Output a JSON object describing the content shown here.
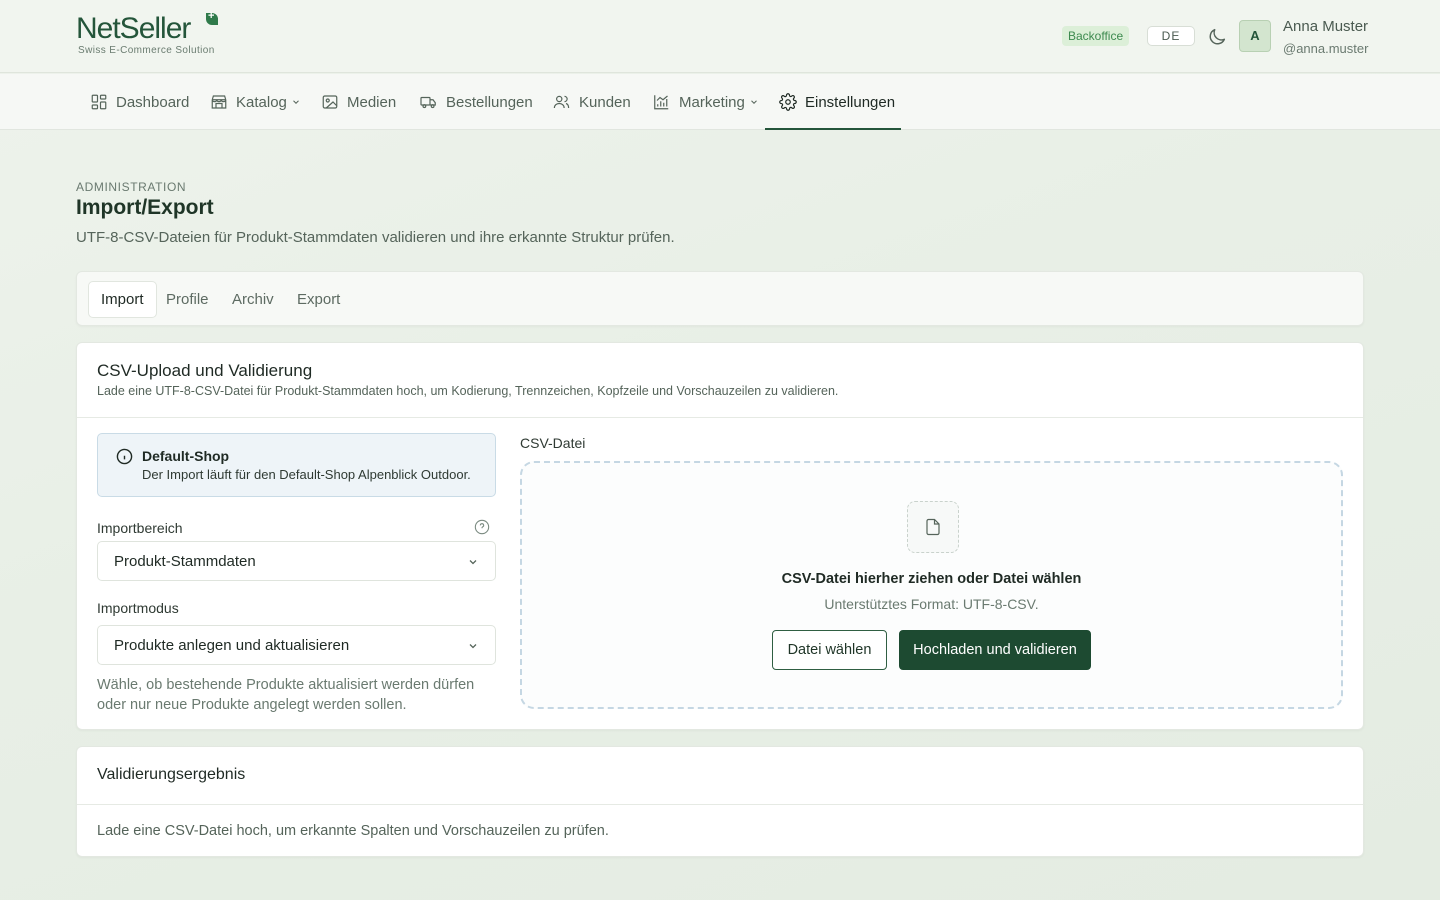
{
  "brand": {
    "name": "NetSeller",
    "tagline": "Swiss E-Commerce Solution"
  },
  "header": {
    "badge": "Backoffice",
    "language": "DE",
    "user": {
      "initial": "A",
      "name": "Anna Muster",
      "handle": "@anna.muster"
    }
  },
  "nav": {
    "items": [
      {
        "label": "Dashboard",
        "icon": "dashboard-icon"
      },
      {
        "label": "Katalog",
        "icon": "store-icon",
        "dropdown": true
      },
      {
        "label": "Medien",
        "icon": "image-icon"
      },
      {
        "label": "Bestellungen",
        "icon": "truck-icon"
      },
      {
        "label": "Kunden",
        "icon": "users-icon"
      },
      {
        "label": "Marketing",
        "icon": "chart-icon",
        "dropdown": true
      },
      {
        "label": "Einstellungen",
        "icon": "gear-icon",
        "active": true
      }
    ]
  },
  "page": {
    "eyebrow": "ADMINISTRATION",
    "title": "Import/Export",
    "description": "UTF-8-CSV-Dateien für Produkt-Stammdaten validieren und ihre erkannte Struktur prüfen."
  },
  "tabs": [
    {
      "label": "Import",
      "active": true
    },
    {
      "label": "Profile"
    },
    {
      "label": "Archiv"
    },
    {
      "label": "Export"
    }
  ],
  "upload": {
    "title": "CSV-Upload und Validierung",
    "subtitle": "Lade eine UTF-8-CSV-Datei für Produkt-Stammdaten hoch, um Kodierung, Trennzeichen, Kopfzeile und Vorschauzeilen zu validieren.",
    "info": {
      "title": "Default-Shop",
      "text": "Der Import läuft für den Default-Shop Alpenblick Outdoor."
    },
    "import_area": {
      "label": "Importbereich",
      "value": "Produkt-Stammdaten"
    },
    "import_mode": {
      "label": "Importmodus",
      "value": "Produkte anlegen und aktualisieren",
      "hint": "Wähle, ob bestehende Produkte aktualisiert werden dürfen oder nur neue Produkte angelegt werden sollen."
    },
    "file": {
      "label": "CSV-Datei",
      "drop_title": "CSV-Datei hierher ziehen oder Datei wählen",
      "drop_sub": "Unterstütztes Format: UTF-8-CSV.",
      "choose_label": "Datei wählen",
      "submit_label": "Hochladen und validieren"
    }
  },
  "result": {
    "title": "Validierungsergebnis",
    "text": "Lade eine CSV-Datei hoch, um erkannte Spalten und Vorschauzeilen zu prüfen."
  },
  "colors": {
    "brand": "#24553a",
    "primary_button": "#1d4a31",
    "badge_bg": "#dcefd8",
    "info_bg": "#eef4f8"
  }
}
